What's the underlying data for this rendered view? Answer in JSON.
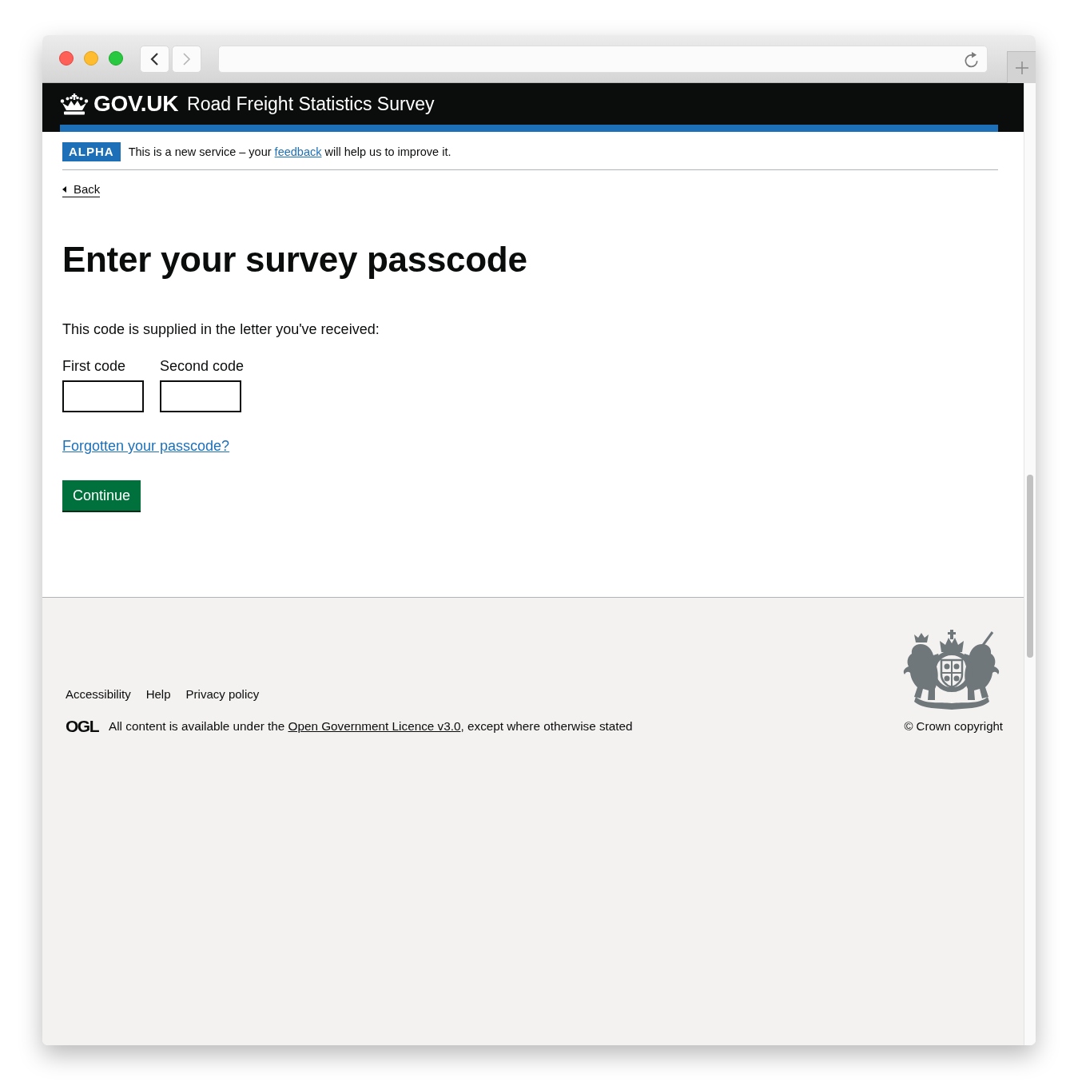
{
  "browser": {
    "nav_buttons": [
      {
        "kind": "back",
        "disabled": false
      },
      {
        "kind": "forward",
        "disabled": true
      }
    ]
  },
  "header": {
    "logo_text": "GOV.UK",
    "service_name": "Road Freight Statistics Survey"
  },
  "phase_banner": {
    "tag": "ALPHA",
    "text_before": "This is a new service – your",
    "link": "feedback",
    "text_after": "will help us to improve it."
  },
  "back_link": "Back",
  "heading": "Enter your survey passcode",
  "hint": "This code is supplied in the letter you've received:",
  "fields": [
    {
      "label": "First code"
    },
    {
      "label": "Second code"
    }
  ],
  "forgotten_link": "Forgotten your passcode?",
  "button": "Continue",
  "footer": {
    "links": [
      "Accessibility",
      "Help",
      "Privacy policy"
    ],
    "ogl_logo": "OGL",
    "licence_before": "All content is available under the",
    "licence_link": "Open Government Licence v3.0",
    "licence_after": ", except where otherwise stated",
    "copyright": "© Crown copyright"
  }
}
